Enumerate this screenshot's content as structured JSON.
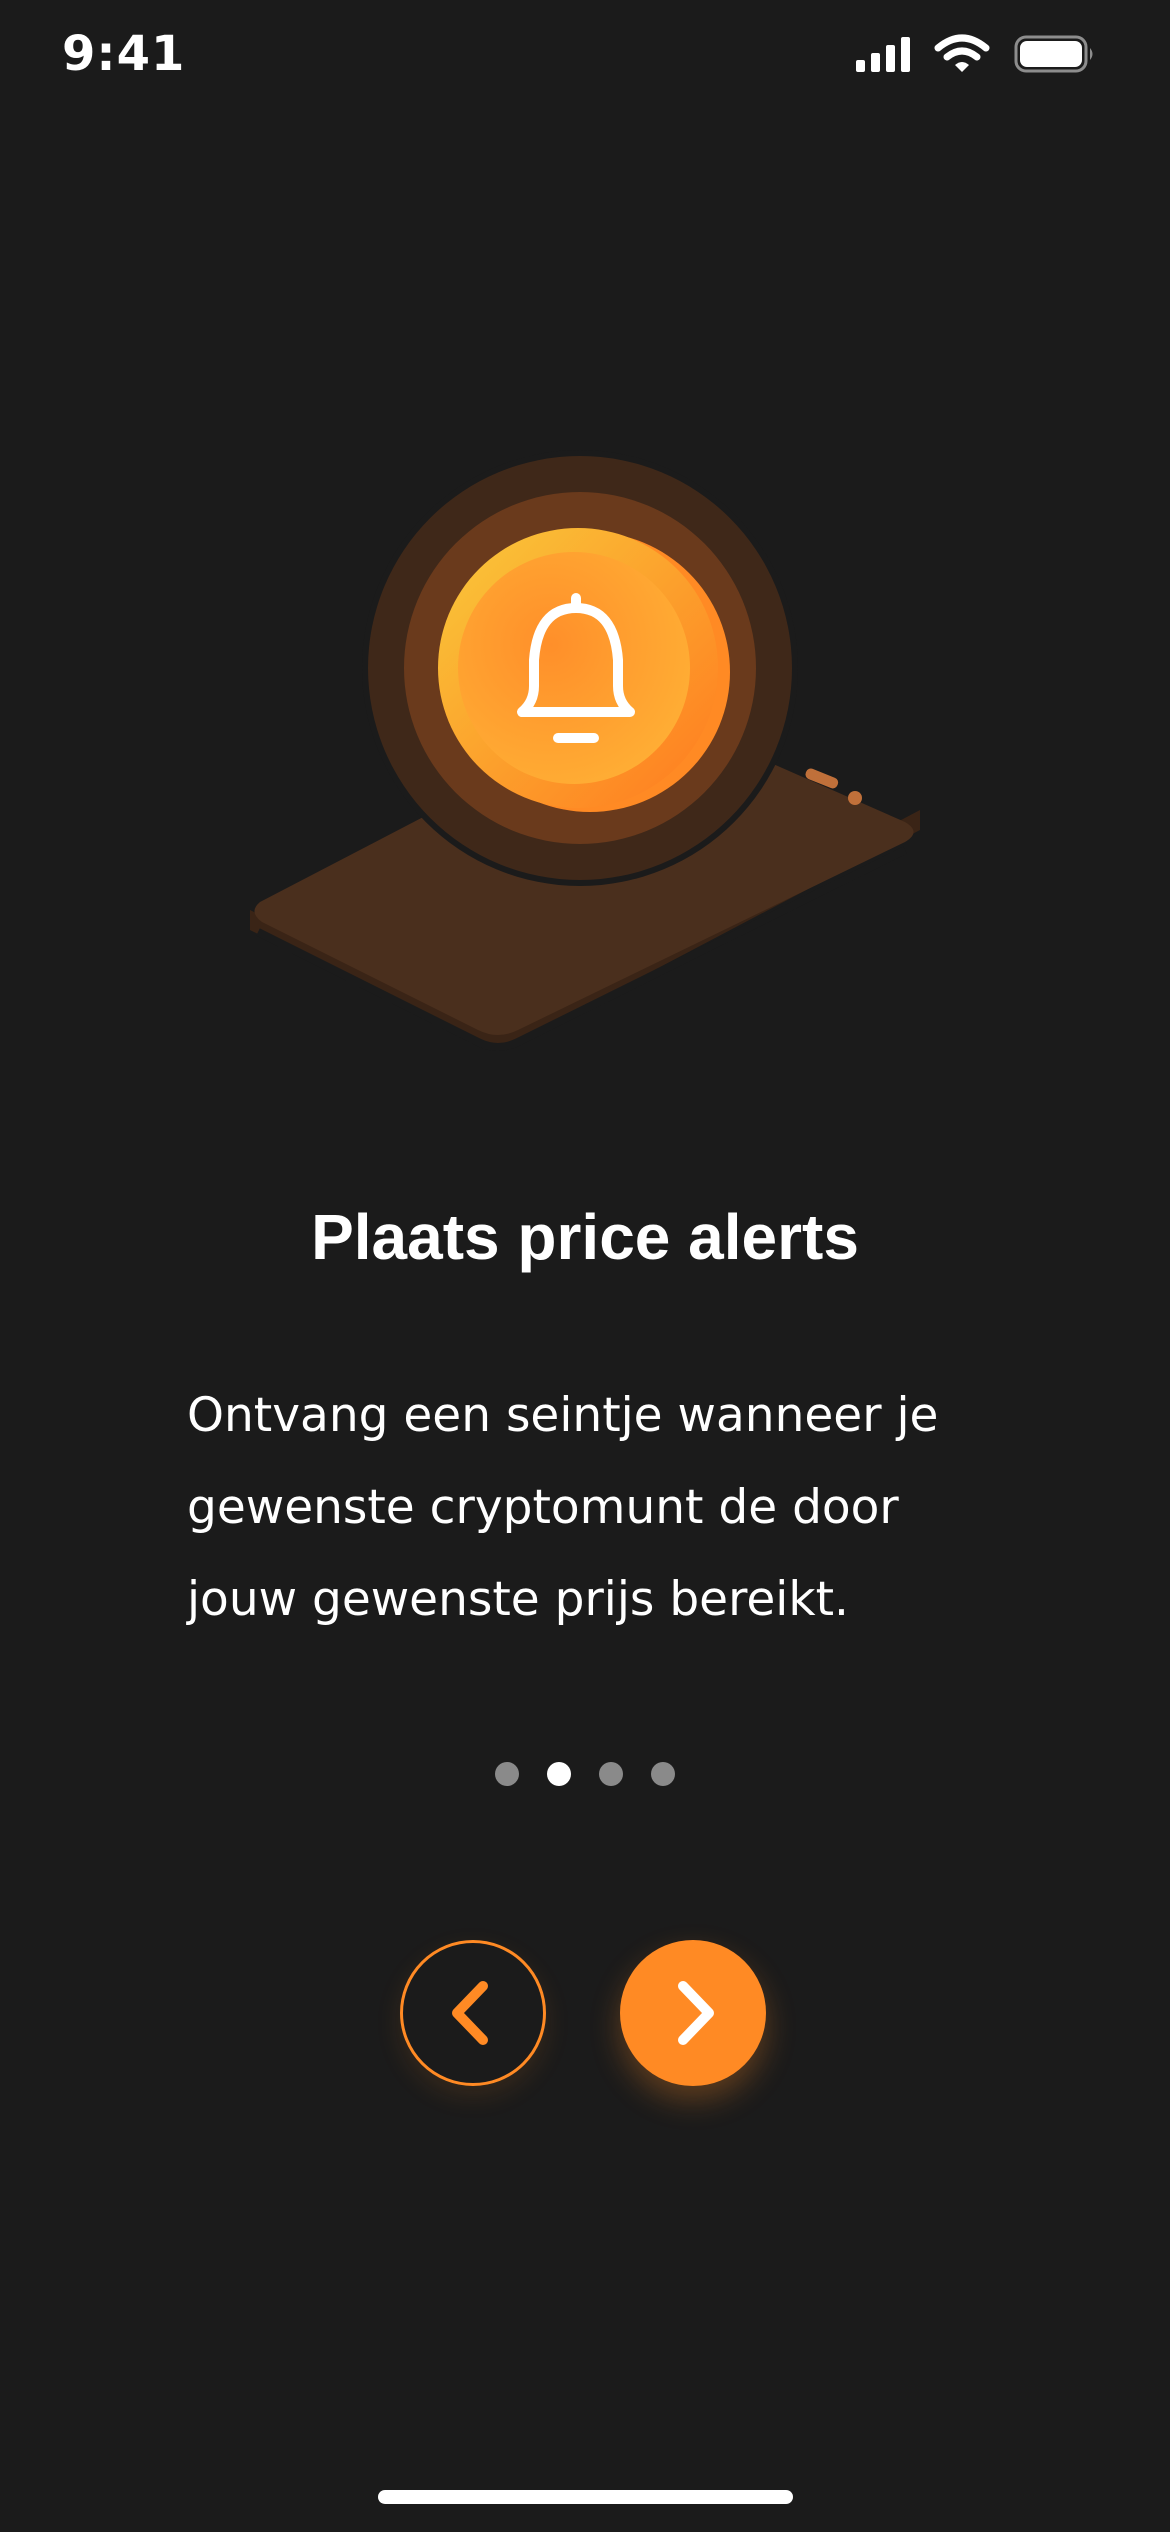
{
  "status_bar": {
    "time": "9:41",
    "icons": [
      "signal-icon",
      "wifi-icon",
      "battery-icon"
    ]
  },
  "onboarding": {
    "illustration": "bell-on-phone-illustration",
    "title": "Plaats price alerts",
    "description": "Ontvang een seintje wanneer je gewenste cryptomunt de door jouw gewenste prijs bereikt.",
    "pagination": {
      "total": 4,
      "current": 2
    },
    "prev_icon": "chevron-left-icon",
    "next_icon": "chevron-right-icon"
  },
  "colors": {
    "background": "#1b1b1b",
    "accent": "#ff8a24",
    "text": "#ffffff",
    "dot_inactive": "#8a8a8a",
    "phone_brown": "#4a2f1d"
  }
}
